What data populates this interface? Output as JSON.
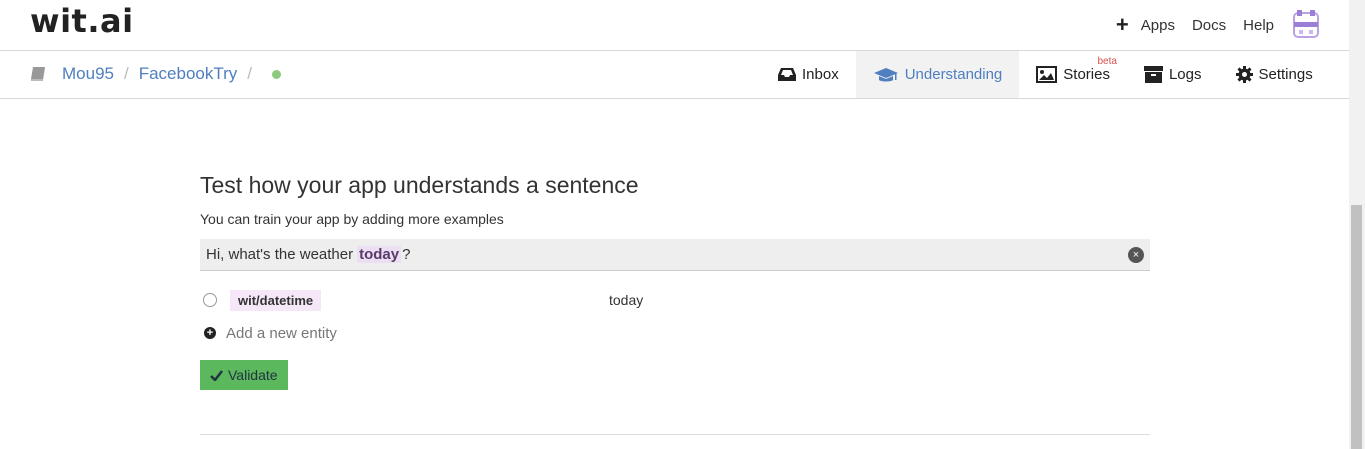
{
  "logo": "wit.ai",
  "topnav": {
    "add": "+",
    "apps": "Apps",
    "docs": "Docs",
    "help": "Help"
  },
  "breadcrumb": {
    "user": "Mou95",
    "app": "FacebookTry",
    "sep": "/"
  },
  "tabs": [
    {
      "label": "Inbox",
      "icon": "inbox-icon"
    },
    {
      "label": "Understanding",
      "icon": "graduation-cap-icon",
      "active": true
    },
    {
      "label": "Stories",
      "icon": "image-icon",
      "badge": "beta"
    },
    {
      "label": "Logs",
      "icon": "archive-icon"
    },
    {
      "label": "Settings",
      "icon": "gear-icon"
    }
  ],
  "main": {
    "title": "Test how your app understands a sentence",
    "subtitle": "You can train your app by adding more examples",
    "sentence": {
      "before": "Hi, what's the weather",
      "highlight": "today",
      "after": "?",
      "clear": "×"
    },
    "entity": {
      "name": "wit/datetime",
      "value": "today"
    },
    "add_entity": "Add a new entity",
    "validate": "Validate"
  },
  "colors": {
    "link": "#4f7fbf",
    "validate": "#5cb85c",
    "status_dot": "#8bc97b",
    "beta": "#d9534f"
  }
}
